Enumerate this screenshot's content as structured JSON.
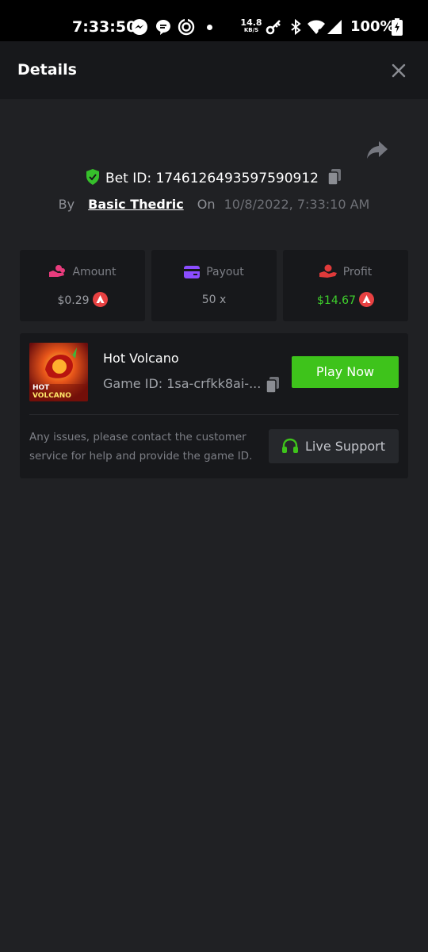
{
  "status_bar": {
    "time": "7:33:50",
    "net_speed_value": "14.8",
    "net_speed_unit": "KB/S",
    "battery": "100%",
    "icons": [
      "messenger-icon",
      "chat-bubble-icon",
      "spinner-app-icon",
      "notification-dot",
      "key-icon",
      "bluetooth-icon",
      "wifi-icon",
      "cellular-signal-icon",
      "battery-charging-icon"
    ]
  },
  "header": {
    "title": "Details",
    "close_icon": "close-icon"
  },
  "bet": {
    "id_label": "Bet ID: 1746126493597590912",
    "by_label": "By",
    "user": "Basic Thedric",
    "on_label": "On",
    "date": "10/8/2022, 7:33:10 AM"
  },
  "stats": {
    "amount": {
      "label": "Amount",
      "value": "$0.29",
      "icon": "hand-coins-icon"
    },
    "payout": {
      "label": "Payout",
      "value": "50 x",
      "icon": "card-icon"
    },
    "profit": {
      "label": "Profit",
      "value": "$14.67",
      "icon": "hand-profit-icon"
    }
  },
  "game": {
    "name": "Hot Volcano",
    "id_label": "Game ID: 1sa-crfkk8ai-...",
    "play_label": "Play Now",
    "thumb_text_line1": "HOT",
    "thumb_text_line2": "VOLCANO"
  },
  "support": {
    "help_text": "Any issues, please contact the customer service for help and provide the game ID.",
    "button_label": "Live Support"
  },
  "colors": {
    "background": "#202124",
    "card": "#17181b",
    "accent_green": "#3ec31b",
    "profit_green": "#3fd02c",
    "coin_red": "#e84142",
    "amount_pink": "#e83c7d",
    "payout_purple": "#8b4dff",
    "profit_red": "#e03a3a"
  }
}
